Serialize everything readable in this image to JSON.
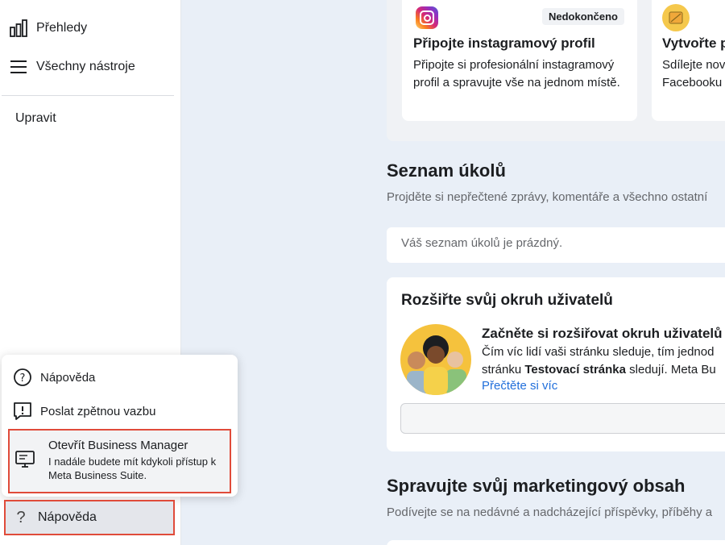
{
  "sidebar": {
    "overview_label": "Přehledy",
    "all_tools_label": "Všechny nástroje",
    "edit_label": "Upravit"
  },
  "popup": {
    "help_label": "Nápověda",
    "feedback_label": "Poslat zpětnou vazbu",
    "business_manager": {
      "title": "Otevřít Business Manager",
      "description": "I nadále budete mít kdykoli přístup k Meta Business Suite."
    }
  },
  "help_button": {
    "label": "Nápověda"
  },
  "cards": {
    "instagram": {
      "badge": "Nedokončeno",
      "title": "Připojte instagramový profil",
      "description": "Připojte si profesionální instagramový profil a spravujte vše na jednom místě."
    },
    "facebook": {
      "title": "Vytvořte p",
      "description": "Sdílejte nov\nFacebooku"
    }
  },
  "tasks": {
    "title": "Seznam úkolů",
    "subtitle": "Projděte si nepřečtené zprávy, komentáře a všechno ostatní",
    "empty": "Váš seznam úkolů je prázdný."
  },
  "grow": {
    "title": "Rozšiřte svůj okruh uživatelů",
    "heading": "Začněte si rozšiřovat okruh uživatelů",
    "line1": "Čím víc lidí vaši stránku sleduje, tím jednod",
    "line2_pre": "stránku ",
    "line2_bold": "Testovací stránka",
    "line2_post": " sledují. Meta Bu",
    "link": "Přečtěte si víc"
  },
  "marketing": {
    "title": "Spravujte svůj marketingový obsah",
    "subtitle": "Podívejte se na nedávné a nadcházející příspěvky, příběhy a"
  }
}
